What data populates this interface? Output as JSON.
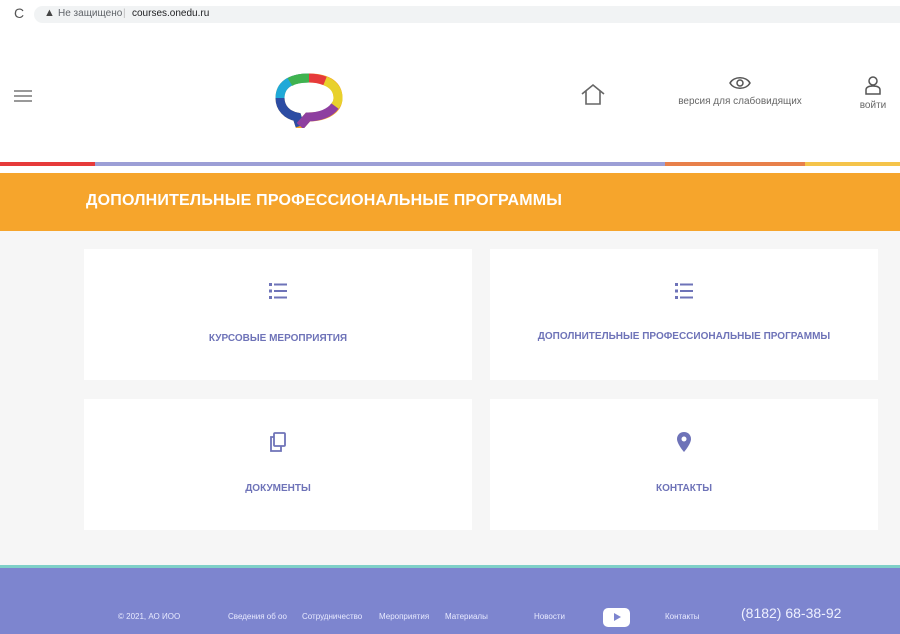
{
  "browser": {
    "reload_glyph": "C",
    "warning_glyph": "▲",
    "insecure_label": "Не защищено",
    "separator": "|",
    "url": "courses.onedu.ru"
  },
  "header": {
    "home_icon": "home-icon",
    "eye_label": "версия для слабовидящих",
    "login_label": "войти"
  },
  "stripe_colors": [
    "#e63a3a",
    "#9c9fd6",
    "#e8804a",
    "#f5c44a"
  ],
  "banner": {
    "title": "ДОПОЛНИТЕЛЬНЫЕ ПРОФЕССИОНАЛЬНЫЕ ПРОГРАММЫ",
    "color": "#f6a52c"
  },
  "cards": [
    {
      "label": "КУРСОВЫЕ МЕРОПРИЯТИЯ",
      "icon": "list-icon"
    },
    {
      "label": "ДОПОЛНИТЕЛЬНЫЕ ПРОФЕССИОНАЛЬНЫЕ ПРОГРАММЫ",
      "icon": "list-icon"
    },
    {
      "label": "ДОКУМЕНТЫ",
      "icon": "documents-icon"
    },
    {
      "label": "КОНТАКТЫ",
      "icon": "map-pin-icon"
    }
  ],
  "footer": {
    "copyright": "© 2021, АО ИОО",
    "links": [
      "Сведения об оо",
      "Сотрудничество",
      "Мероприятия",
      "Материалы",
      "Новости",
      "Контакты"
    ],
    "phone": "(8182) 68-38-92",
    "color": "#7d85cf"
  }
}
